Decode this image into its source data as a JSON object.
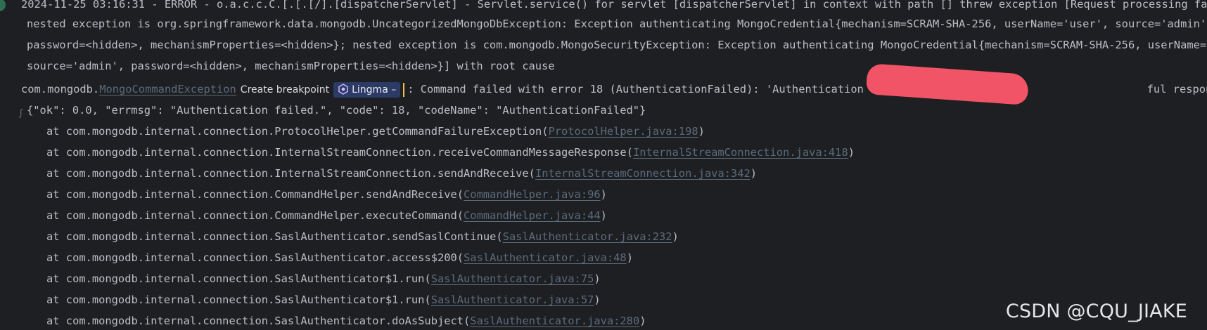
{
  "log": {
    "line0": "2024-11-25 03:16:31 - ERROR - o.a.c.c.C.[.[.[/].[dispatcherServlet] - Servlet.service() for servlet [dispatcherServlet] in context with path [] threw exception [Request processing failed;",
    "line1": "nested exception is org.springframework.data.mongodb.UncategorizedMongoDbException: Exception authenticating MongoCredential{mechanism=SCRAM-SHA-256, userName='user', source='admin',",
    "line2": "password=<hidden>, mechanismProperties=<hidden>}; nested exception is com.mongodb.MongoSecurityException: Exception authenticating MongoCredential{mechanism=SCRAM-SHA-256, userName='user",
    "line3": "source='admin', password=<hidden>, mechanismProperties=<hidden>}] with root cause",
    "exception_prefix": "com.mongodb.",
    "exception_link": "MongoCommandException",
    "create_breakpoint": "Create breakpoint",
    "lingma_label": "Lingma",
    "lingma_dash": "–",
    "exception_message": ": Command failed with error 18 (AuthenticationFailed): 'Authentication failed.' on serve",
    "exception_message_tail": "ful response i",
    "json_line": "{\"ok\": 0.0, \"errmsg\": \"Authentication failed.\", \"code\": 18, \"codeName\": \"AuthenticationFailed\"}",
    "fold_marker": "ʃ"
  },
  "stack": [
    {
      "prefix": "at com.mongodb.internal.connection.ProtocolHelper.getCommandFailureException(",
      "link": "ProtocolHelper.java:198",
      "suffix": ")"
    },
    {
      "prefix": "at com.mongodb.internal.connection.InternalStreamConnection.receiveCommandMessageResponse(",
      "link": "InternalStreamConnection.java:418",
      "suffix": ")"
    },
    {
      "prefix": "at com.mongodb.internal.connection.InternalStreamConnection.sendAndReceive(",
      "link": "InternalStreamConnection.java:342",
      "suffix": ")"
    },
    {
      "prefix": "at com.mongodb.internal.connection.CommandHelper.sendAndReceive(",
      "link": "CommandHelper.java:96",
      "suffix": ")"
    },
    {
      "prefix": "at com.mongodb.internal.connection.CommandHelper.executeCommand(",
      "link": "CommandHelper.java:44",
      "suffix": ")"
    },
    {
      "prefix": "at com.mongodb.internal.connection.SaslAuthenticator.sendSaslContinue(",
      "link": "SaslAuthenticator.java:232",
      "suffix": ")"
    },
    {
      "prefix": "at com.mongodb.internal.connection.SaslAuthenticator.access$200(",
      "link": "SaslAuthenticator.java:48",
      "suffix": ")"
    },
    {
      "prefix": "at com.mongodb.internal.connection.SaslAuthenticator$1.run(",
      "link": "SaslAuthenticator.java:75",
      "suffix": ")"
    },
    {
      "prefix": "at com.mongodb.internal.connection.SaslAuthenticator$1.run(",
      "link": "SaslAuthenticator.java:57",
      "suffix": ")"
    },
    {
      "prefix": "at com.mongodb.internal.connection.SaslAuthenticator.doAsSubject(",
      "link": "SaslAuthenticator.java:280",
      "suffix": ")"
    }
  ],
  "watermark": "CSDN @CQU_JIAKE",
  "colors": {
    "background": "#1e1f22",
    "text": "#bcbec4",
    "link": "#5c6b7b",
    "redaction": "#f25467",
    "lingma_bg": "#2c3a66"
  }
}
